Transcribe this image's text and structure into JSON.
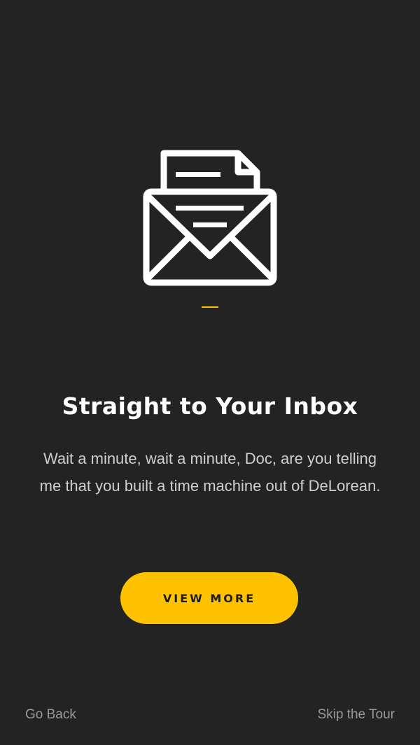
{
  "onboarding": {
    "icon": "open-envelope-letter-icon",
    "title": "Straight to Your Inbox",
    "description": "Wait a minute, wait a minute, Doc, are you telling me that you built a time machine out of DeLorean.",
    "cta_label": "VIEW MORE"
  },
  "footer": {
    "go_back_label": "Go Back",
    "skip_label": "Skip the Tour"
  },
  "colors": {
    "background": "#232323",
    "accent": "#FFC200",
    "title_text": "#FFFFFF",
    "body_text": "#CFCFCF",
    "footer_text": "#9A9A9A"
  }
}
